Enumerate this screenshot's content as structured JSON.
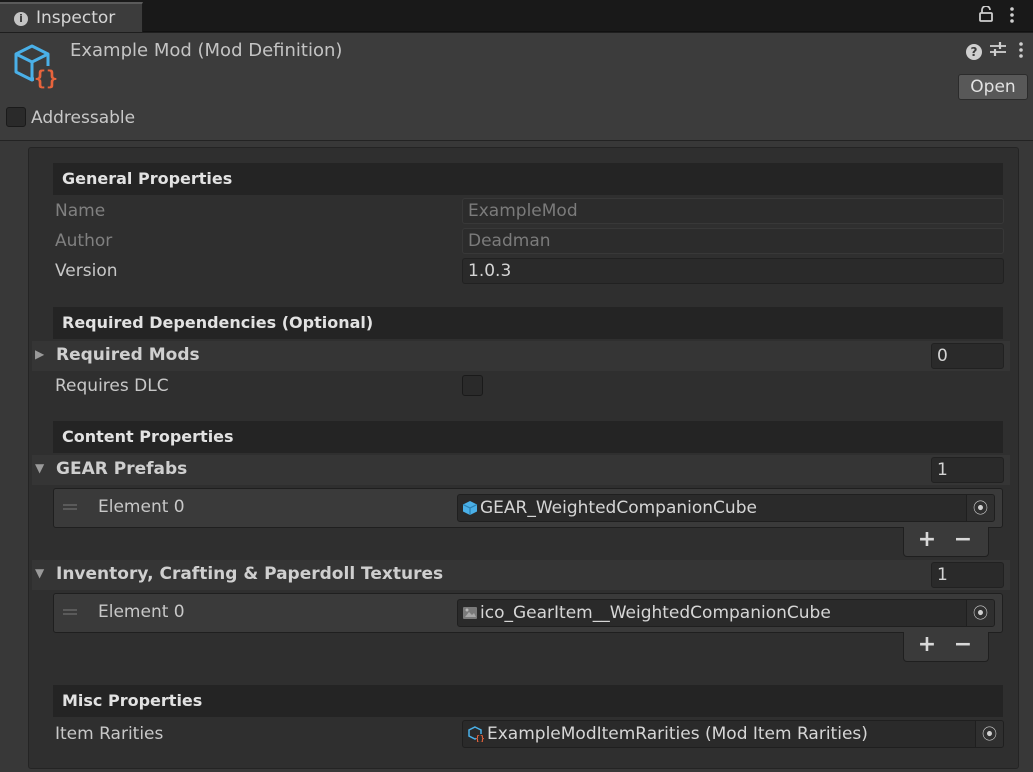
{
  "window": {
    "tab_label": "Inspector",
    "tab_info_icon": "i",
    "lock_icon": "lock-icon",
    "menu_icon": "more-icon"
  },
  "header": {
    "title": "Example Mod (Mod Definition)",
    "asset_icon": "mod-definition-icon",
    "help_icon": "?",
    "open_button": "Open",
    "addressable_label": "Addressable",
    "addressable_checked": false
  },
  "general": {
    "title": "General Properties",
    "name_label": "Name",
    "name_value": "ExampleMod",
    "author_label": "Author",
    "author_value": "Deadman",
    "version_label": "Version",
    "version_value": "1.0.3"
  },
  "dependencies": {
    "title": "Required Dependencies (Optional)",
    "required_mods_label": "Required Mods",
    "required_mods_count": "0",
    "requires_dlc_label": "Requires DLC",
    "requires_dlc_checked": false
  },
  "content": {
    "title": "Content Properties",
    "gear_label": "GEAR Prefabs",
    "gear_count": "1",
    "gear_elements": [
      {
        "label": "Element 0",
        "value": "GEAR_WeightedCompanionCube"
      }
    ],
    "textures_label": "Inventory, Crafting & Paperdoll Textures",
    "textures_count": "1",
    "texture_elements": [
      {
        "label": "Element 0",
        "value": "ico_GearItem__WeightedCompanionCube"
      }
    ],
    "add_symbol": "+",
    "remove_symbol": "−"
  },
  "misc": {
    "title": "Misc Properties",
    "rarities_label": "Item Rarities",
    "rarities_value": "ExampleModItemRarities (Mod Item Rarities)"
  }
}
